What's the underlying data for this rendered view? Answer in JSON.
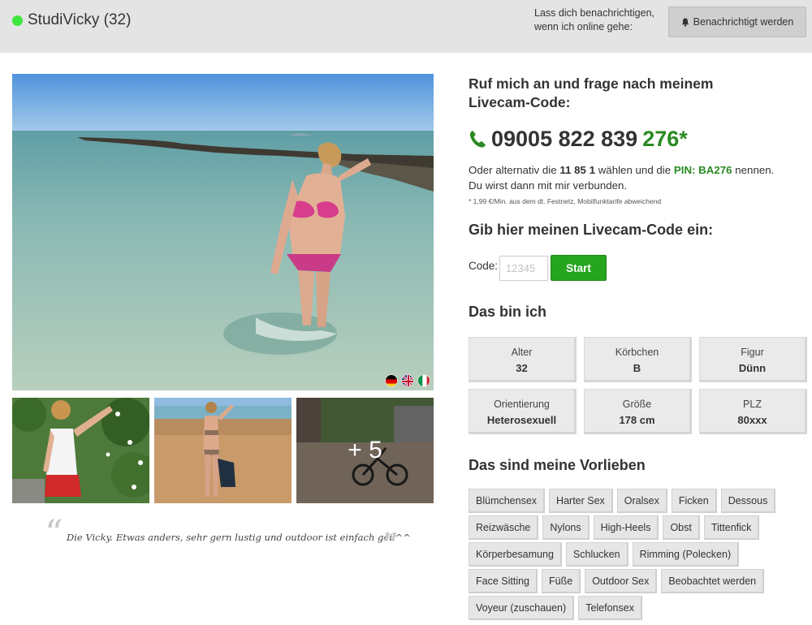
{
  "header": {
    "name_age": "StudiVicky (32)",
    "notify_text_line1": "Lass dich benachrichtigen,",
    "notify_text_line2": "wenn ich online gehe:",
    "notify_button": "Benachrichtigt werden",
    "online_color": "#3ee53e"
  },
  "gallery": {
    "more_count": "+ 5",
    "languages": [
      "german-flag-icon",
      "uk-flag-icon",
      "italian-flag-icon"
    ]
  },
  "quote": {
    "text": "Die Vicky. Etwas anders, sehr gern lustig und outdoor ist einfach geil^^"
  },
  "call": {
    "heading": "Ruf mich an und frage nach meinem Livecam-Code:",
    "phone_main": "09005 822 839",
    "phone_ext": "276*",
    "alt_prefix": "Oder alternativ die",
    "alt_number": "11 85 1",
    "alt_middle": "wählen und die",
    "alt_pin": "PIN: BA276",
    "alt_suffix": "nennen.",
    "alt_line2": "Du wirst dann mit mir verbunden.",
    "fine_print": "* 1,99 €/Min. aus dem dt. Festnetz, Mobilfunktarife abweichend",
    "accent_color": "#2a8a22"
  },
  "code_entry": {
    "heading": "Gib hier meinen Livecam-Code ein:",
    "label": "Code:",
    "placeholder": "12345",
    "button": "Start"
  },
  "about": {
    "heading": "Das bin ich",
    "attributes": [
      {
        "label": "Alter",
        "value": "32"
      },
      {
        "label": "Körbchen",
        "value": "B"
      },
      {
        "label": "Figur",
        "value": "Dünn"
      },
      {
        "label": "Orientierung",
        "value": "Heterosexuell"
      },
      {
        "label": "Größe",
        "value": "178 cm"
      },
      {
        "label": "PLZ",
        "value": "80xxx"
      }
    ]
  },
  "preferences": {
    "heading": "Das sind meine Vorlieben",
    "tags": [
      "Blümchensex",
      "Harter Sex",
      "Oralsex",
      "Ficken",
      "Dessous",
      "Reizwäsche",
      "Nylons",
      "High-Heels",
      "Obst",
      "Tittenfick",
      "Körperbesamung",
      "Schlucken",
      "Rimming (Polecken)",
      "Face Sitting",
      "Füße",
      "Outdoor Sex",
      "Beobachtet werden",
      "Voyeur (zuschauen)",
      "Telefonsex"
    ]
  }
}
